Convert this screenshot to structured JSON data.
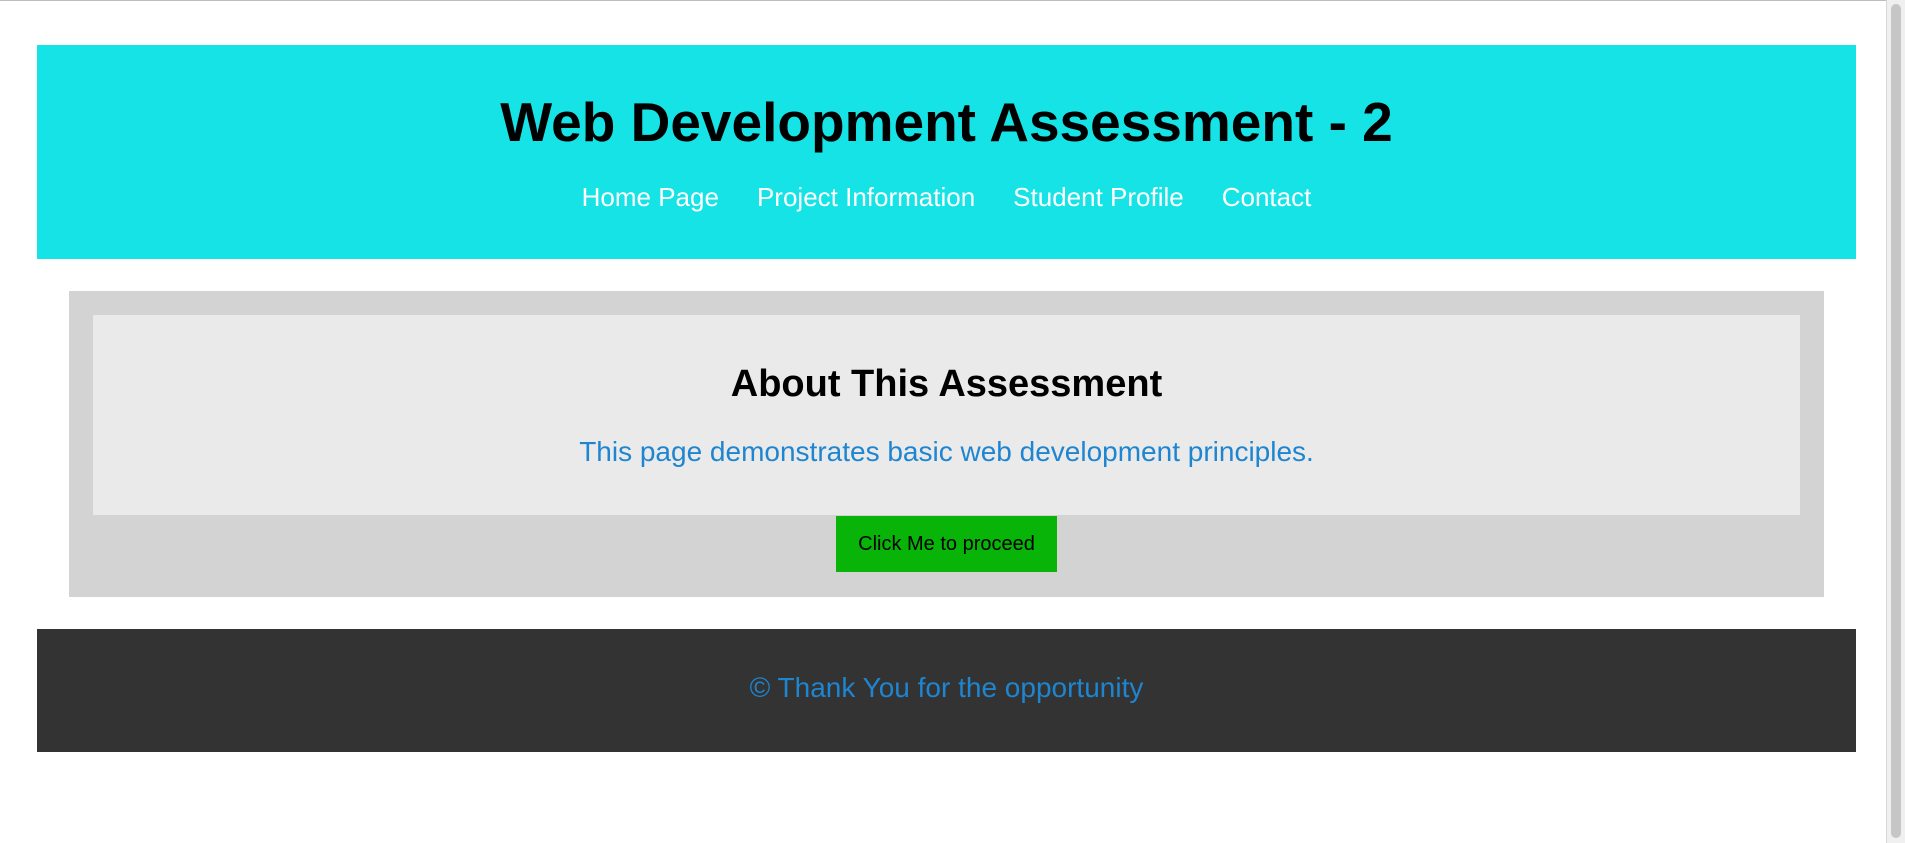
{
  "header": {
    "title": "Web Development Assessment - 2",
    "nav": [
      {
        "label": "Home Page"
      },
      {
        "label": "Project Information"
      },
      {
        "label": "Student Profile"
      },
      {
        "label": "Contact"
      }
    ]
  },
  "main": {
    "title": "About This Assessment",
    "text": "This page demonstrates basic web development principles.",
    "button_label": "Click Me to proceed"
  },
  "footer": {
    "text": "© Thank You for the opportunity"
  },
  "colors": {
    "header_bg": "#16e3e6",
    "section_bg": "#d3d3d3",
    "card_bg": "#eaeaea",
    "accent_text": "#1e85d0",
    "button_bg": "#07b407",
    "footer_bg": "#333333"
  }
}
